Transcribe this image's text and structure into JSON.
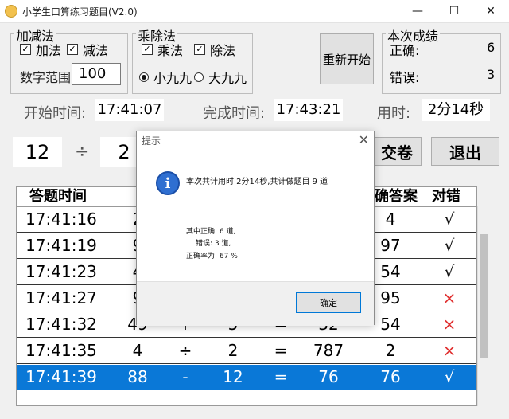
{
  "window": {
    "title": "小学生口算练习题目(V2.0)",
    "min": "—",
    "max": "☐",
    "close": "✕"
  },
  "add_sub": {
    "group": "加减法",
    "add": "加法",
    "sub": "减法",
    "range_label": "数字范围:",
    "range_value": "100",
    "checked": true
  },
  "mul_div": {
    "group": "乘除法",
    "mul": "乘法",
    "div": "除法",
    "small": "小九九",
    "big": "大九九"
  },
  "restart": "重新开始",
  "score": {
    "group": "本次成绩",
    "correct_label": "正确:",
    "correct": "6",
    "wrong_label": "错误:",
    "wrong": "3"
  },
  "times": {
    "start_label": "开始时间:",
    "start": "17:41:07",
    "end_label": "完成时间:",
    "end": "17:43:21",
    "used_label": "用时:",
    "used": "2分14秒"
  },
  "question": {
    "a": "12",
    "op": "÷",
    "b": "2"
  },
  "buttons": {
    "submit": "交卷",
    "exit": "退出"
  },
  "table": {
    "headers": [
      "答题时间",
      "确答案",
      "对错"
    ],
    "rows": [
      {
        "time": "17:41:16",
        "a": "2",
        "op": "",
        "b": "",
        "eq": "",
        "ans": "",
        "right": "4",
        "mark": "√"
      },
      {
        "time": "17:41:19",
        "a": "9",
        "op": "",
        "b": "",
        "eq": "",
        "ans": "",
        "right": "97",
        "mark": "√"
      },
      {
        "time": "17:41:23",
        "a": "4",
        "op": "",
        "b": "",
        "eq": "",
        "ans": "",
        "right": "54",
        "mark": "√"
      },
      {
        "time": "17:41:27",
        "a": "9",
        "op": "",
        "b": "",
        "eq": "",
        "ans": "",
        "right": "95",
        "mark": "×"
      },
      {
        "time": "17:41:32",
        "a": "49",
        "op": "+",
        "b": "5",
        "eq": "=",
        "ans": "32",
        "right": "54",
        "mark": "×"
      },
      {
        "time": "17:41:35",
        "a": "4",
        "op": "÷",
        "b": "2",
        "eq": "=",
        "ans": "787",
        "right": "2",
        "mark": "×"
      },
      {
        "time": "17:41:39",
        "a": "88",
        "op": "-",
        "b": "12",
        "eq": "=",
        "ans": "76",
        "right": "76",
        "mark": "√"
      }
    ]
  },
  "dialog": {
    "title": "提示",
    "message": "本次共计用时 2分14秒,共计做题目 9 道",
    "line1": "其中正确:  6 道,",
    "line2": "错误:  3 道,",
    "line3": "正确率为:  67 %",
    "ok": "确定",
    "close": "✕",
    "icon": "i"
  },
  "colors": {
    "selected": "#0a78d7",
    "wrong_mark": "#e03030"
  }
}
